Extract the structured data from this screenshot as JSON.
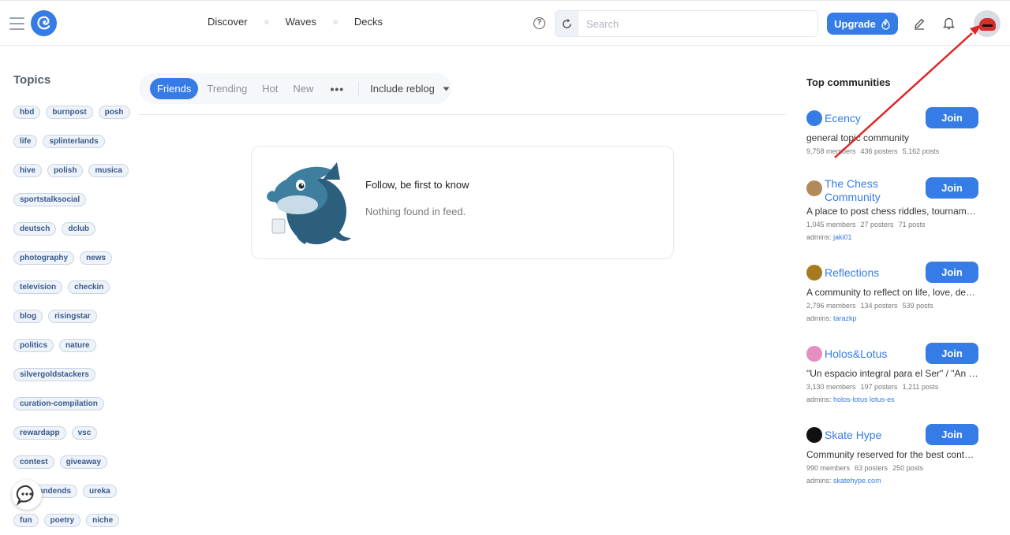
{
  "header": {
    "nav": [
      "Discover",
      "Waves",
      "Decks"
    ],
    "search_placeholder": "Search",
    "upgrade_label": "Upgrade"
  },
  "topics": {
    "title": "Topics",
    "rows": [
      [
        "hbd",
        "burnpost",
        "posh"
      ],
      [
        "life",
        "splinterlands"
      ],
      [
        "hive",
        "polish",
        "musica"
      ],
      [
        "sportstalksocial"
      ],
      [
        "deutsch",
        "dclub"
      ],
      [
        "photography",
        "news"
      ],
      [
        "television",
        "checkin"
      ],
      [
        "blog",
        "risingstar"
      ],
      [
        "politics",
        "nature"
      ],
      [
        "silvergoldstackers"
      ],
      [
        "curation-compilation"
      ],
      [
        "rewardapp",
        "vsc"
      ],
      [
        "contest",
        "giveaway"
      ],
      [
        "oddsandends",
        "ureka"
      ],
      [
        "fun",
        "poetry",
        "niche"
      ]
    ]
  },
  "feed": {
    "tabs": [
      "Friends",
      "Trending",
      "Hot",
      "New"
    ],
    "active_tab": "Friends",
    "more": "•••",
    "reblog_label": "Include reblog",
    "empty_title": "Follow, be first to know",
    "empty_message": "Nothing found in feed."
  },
  "communities": {
    "title": "Top communities",
    "join_label": "Join",
    "items": [
      {
        "name": "Ecency",
        "description": "general topic community",
        "members": "9,758 members",
        "posters": "436 posters",
        "posts": "5,162 posts",
        "admins_label": "",
        "admins": "",
        "icon_color": "#357ce6"
      },
      {
        "name": "The Chess Community",
        "description": "A place to post chess riddles, tournaments and discussions",
        "members": "1,045 members",
        "posters": "27 posters",
        "posts": "71 posts",
        "admins_label": "admins:",
        "admins": "jaki01",
        "icon_color": "#b08a5a"
      },
      {
        "name": "Reflections",
        "description": "A community to reflect on life, love, death and more",
        "members": "2,796 members",
        "posters": "134 posters",
        "posts": "539 posts",
        "admins_label": "admins:",
        "admins": "tarazkp",
        "icon_color": "#a87a1e"
      },
      {
        "name": "Holos&Lotus",
        "description": "\"Un espacio integral para el Ser\" / \"An integral space for the Being\"",
        "members": "3,130 members",
        "posters": "197 posters",
        "posts": "1,211 posts",
        "admins_label": "admins:",
        "admins": "holos-lotus  lotus-es",
        "icon_color": "#e48fbf"
      },
      {
        "name": "Skate Hype",
        "description": "Community reserved for the best content about skateboarding",
        "members": "990 members",
        "posters": "63 posters",
        "posts": "250 posts",
        "admins_label": "admins:",
        "admins": "skatehype.com",
        "icon_color": "#111111"
      }
    ]
  },
  "colors": {
    "accent": "#357ce6",
    "annotation_arrow": "#e02424"
  }
}
